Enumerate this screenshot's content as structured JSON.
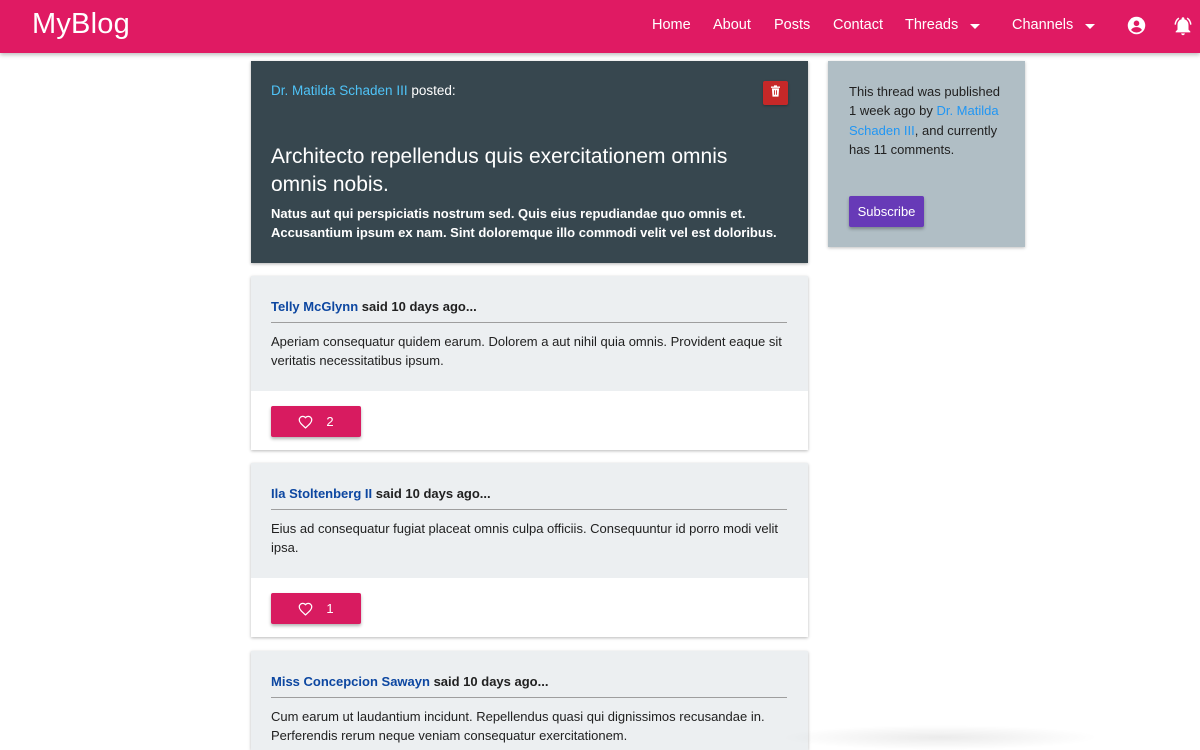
{
  "nav": {
    "brand": "MyBlog",
    "home": "Home",
    "about": "About",
    "posts": "Posts",
    "contact": "Contact",
    "threads": "Threads",
    "channels": "Channels",
    "icons": [
      "account-circle-icon",
      "bell-icon"
    ]
  },
  "thread": {
    "author": "Dr. Matilda Schaden III",
    "posted_suffix": "posted:",
    "title": "Architecto repellendus quis exercitationem omnis omnis nobis.",
    "body": "Natus aut qui perspiciatis nostrum sed. Quis eius repudiandae quo omnis et. Accusantium ipsum ex nam. Sint doloremque illo commodi velit vel est doloribus.",
    "delete_icon": "trash-icon"
  },
  "sidebar": {
    "text_before": "This thread was published 1 week ago by ",
    "author": "Dr. Matilda Schaden III",
    "text_after": ", and currently has 11 comments.",
    "subscribe": "Subscribe"
  },
  "replies": [
    {
      "author": "Telly McGlynn",
      "said": "said 10 days ago...",
      "body": "Aperiam consequatur quidem earum. Dolorem a aut nihil quia omnis. Provident eaque sit veritatis necessitatibus ipsum.",
      "likes": "2"
    },
    {
      "author": "Ila Stoltenberg II",
      "said": "said 10 days ago...",
      "body": "Eius ad consequatur fugiat placeat omnis culpa officiis. Consequuntur id porro modi velit ipsa.",
      "likes": "1"
    },
    {
      "author": "Miss Concepcion Sawayn",
      "said": "said 10 days ago...",
      "body": "Cum earum ut laudantium incidunt. Repellendus quasi qui dignissimos recusandae in. Perferendis rerum neque veniam consequatur exercitationem.",
      "likes": ""
    }
  ],
  "colors": {
    "navbar": "#e01a63",
    "thread_card": "#37474f",
    "sidebar": "#b0bec5",
    "subscribe": "#673ab7",
    "like": "#d81b60",
    "delete": "#c62828"
  }
}
